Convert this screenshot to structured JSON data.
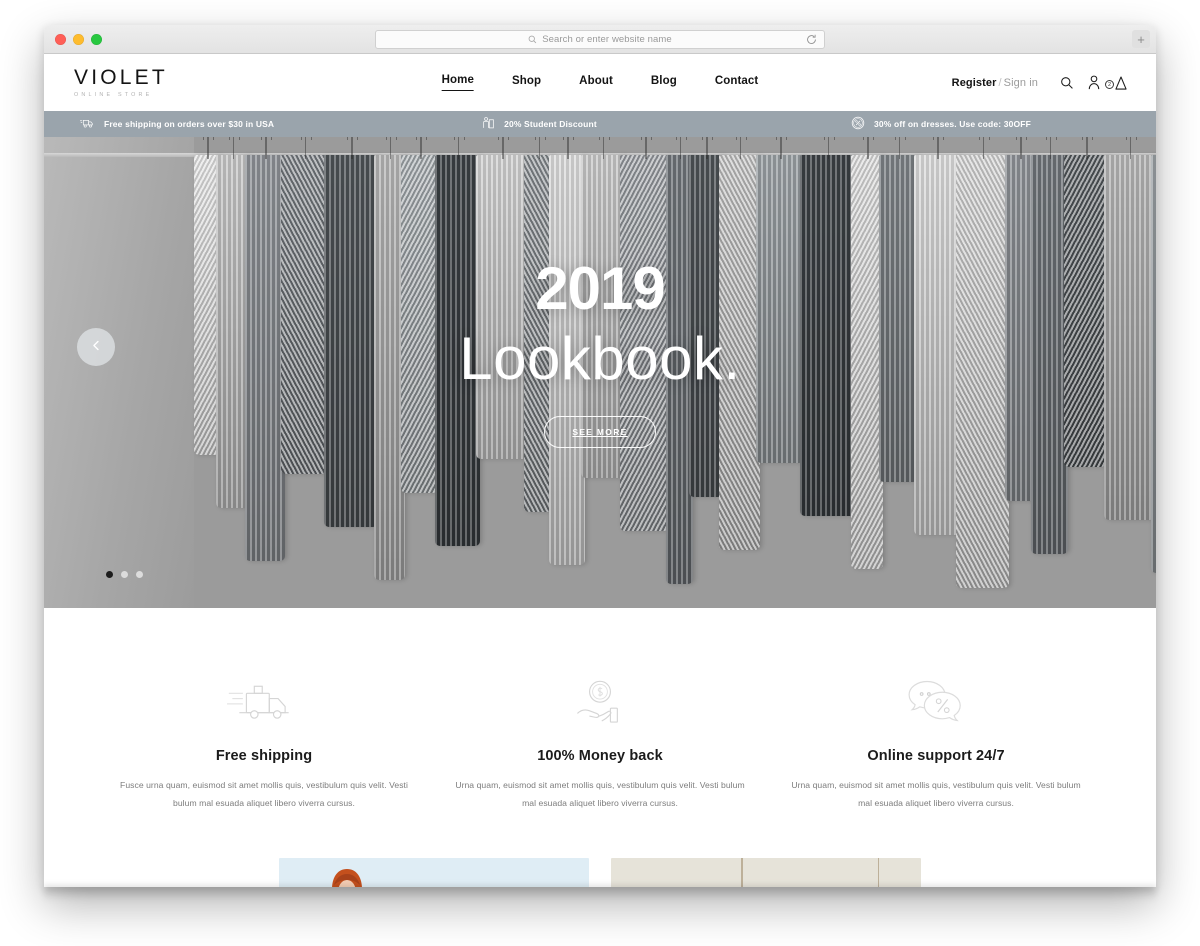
{
  "browser": {
    "url_placeholder": "Search or enter website name",
    "search_icon": "search-icon",
    "reload_icon": "reload-icon",
    "new_tab_label": "+",
    "traffic_lights": [
      "close",
      "minimize",
      "zoom"
    ]
  },
  "header": {
    "logo": {
      "name": "VIOLET",
      "tagline": "ONLINE STORE"
    },
    "nav": [
      {
        "label": "Home",
        "active": true
      },
      {
        "label": "Shop",
        "active": false
      },
      {
        "label": "About",
        "active": false
      },
      {
        "label": "Blog",
        "active": false
      },
      {
        "label": "Contact",
        "active": false
      }
    ],
    "account": {
      "register": "Register",
      "separator": "/",
      "signin": "Sign in"
    },
    "icons": {
      "search": "search-icon",
      "user": "user-icon",
      "cart": "cart-icon"
    },
    "cart_count": "2"
  },
  "promo_bar": {
    "background": "#9aa4ac",
    "items": [
      {
        "icon": "truck-icon",
        "text": "Free shipping on orders over $30 in USA"
      },
      {
        "icon": "student-icon",
        "text": "20% Student Discount"
      },
      {
        "icon": "percent-badge-icon",
        "text": "30% off on dresses. Use code: 30OFF"
      }
    ]
  },
  "hero": {
    "line1": "2019",
    "line2": "Lookbook.",
    "button": "SEE MORE",
    "prev_icon": "chevron-left-icon",
    "slides": 3,
    "active_slide": 1
  },
  "features": [
    {
      "icon": "delivery-truck-icon",
      "title": "Free shipping",
      "text": "Fusce urna quam, euismod sit amet mollis quis, vestibulum quis velit. Vesti bulum mal esuada aliquet libero viverra cursus."
    },
    {
      "icon": "hand-coin-icon",
      "title": "100% Money back",
      "text": "Urna quam, euismod sit amet mollis quis, vestibulum quis velit. Vesti bulum mal esuada aliquet libero viverra cursus."
    },
    {
      "icon": "chat-percent-icon",
      "title": "Online support 24/7",
      "text": "Urna quam, euismod sit amet mollis quis, vestibulum quis velit. Vesti bulum mal esuada aliquet libero viverra cursus."
    }
  ],
  "bottom_cards": [
    {
      "name": "promo-card-portrait",
      "background": "#dfedf5"
    },
    {
      "name": "promo-card-beige",
      "background": "#e6e3d9"
    }
  ],
  "colors": {
    "text_dark": "#141414",
    "muted": "#7d7d7d",
    "promo_bg": "#9aa4ac",
    "card_blue": "#dfedf5",
    "card_beige": "#e6e3d9"
  }
}
